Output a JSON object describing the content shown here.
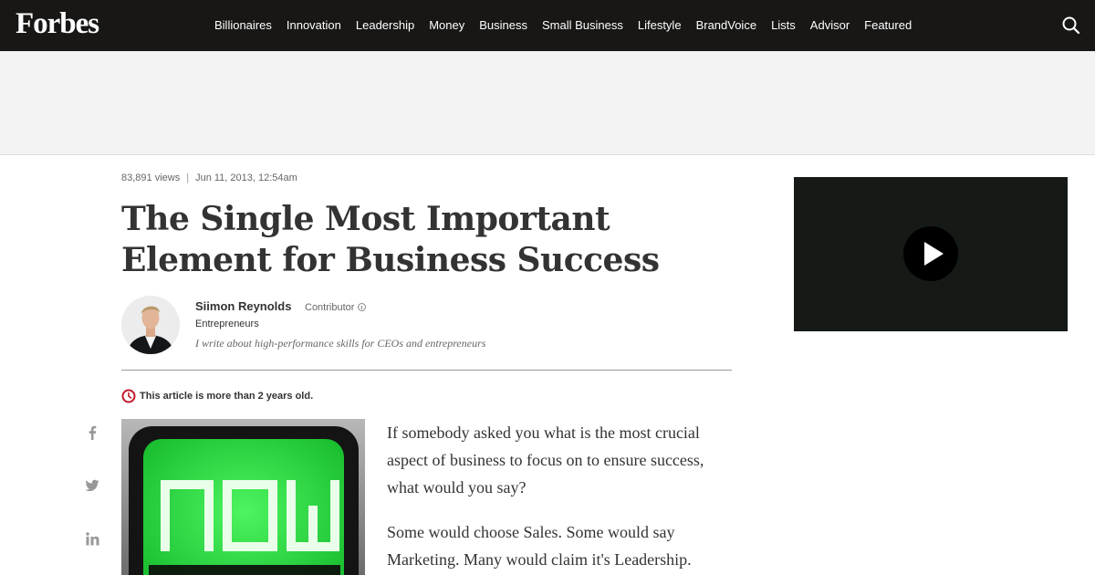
{
  "header": {
    "logo": "Forbes",
    "nav": [
      "Billionaires",
      "Innovation",
      "Leadership",
      "Money",
      "Business",
      "Small Business",
      "Lifestyle",
      "BrandVoice",
      "Lists",
      "Advisor",
      "Featured"
    ],
    "search_icon": "search-icon"
  },
  "article": {
    "views": "83,891 views",
    "separator": "|",
    "date": "Jun 11, 2013, 12:54am",
    "title": "The Single Most Important Element for Business Success",
    "author": {
      "name": "Siimon Reynolds",
      "role": "Contributor",
      "channel": "Entrepreneurs",
      "bio": "I write about high-performance skills for CEOs and entrepreneurs"
    },
    "age_notice": "This article is more than 2 years old.",
    "image_word": "now",
    "paragraphs": [
      "If somebody asked you what is the most crucial aspect of business to focus on to ensure success, what would you say?",
      "Some would choose Sales. Some would say Marketing. Many would claim it's Leadership."
    ]
  },
  "share": [
    "facebook-icon",
    "twitter-icon",
    "linkedin-icon"
  ],
  "colors": {
    "header_bg": "#181716",
    "ad_band": "#f3f3f3",
    "alert_red": "#c0172a",
    "video_bg": "#161a17",
    "screen_green": "#1fd33a"
  }
}
